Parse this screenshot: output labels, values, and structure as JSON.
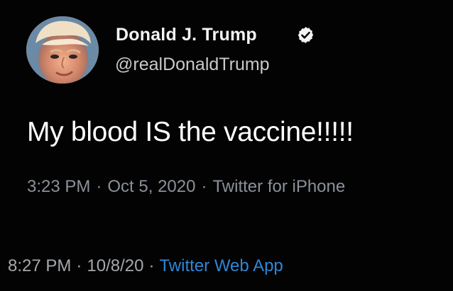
{
  "tweet": {
    "author": {
      "display_name": "Donald J. Trump",
      "handle": "@realDonaldTrump",
      "verified_icon": "verified-badge-icon"
    },
    "text": "My blood IS the vaccine!!!!!",
    "meta": {
      "time": "3:23 PM",
      "date": "Oct 5, 2020",
      "client": "Twitter for iPhone",
      "separator": "·"
    }
  },
  "footer": {
    "time": "8:27 PM",
    "date": "10/8/20",
    "source": "Twitter Web App",
    "separator": "·"
  },
  "colors": {
    "background": "#030303",
    "primary_text": "#ffffff",
    "secondary_text": "#8a9199",
    "link_blue": "#2f86d5"
  }
}
